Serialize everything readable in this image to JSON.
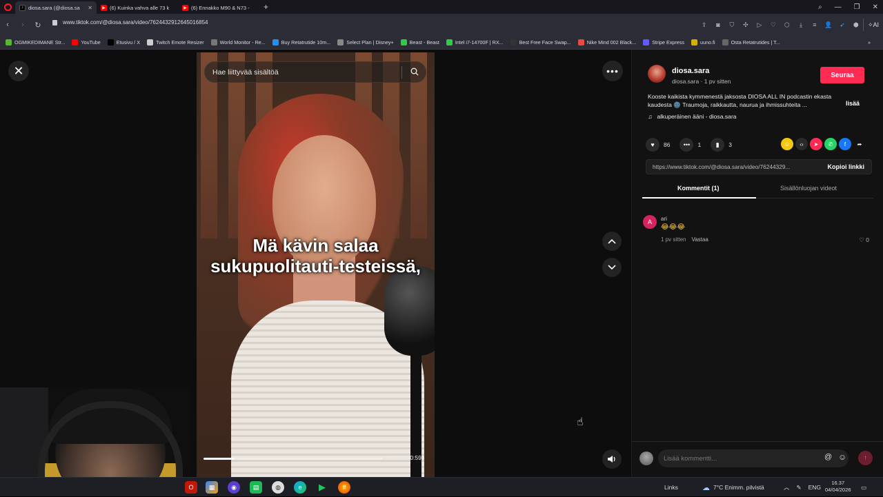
{
  "browser": {
    "tabs": [
      {
        "label": "diosa.sara (@diosa.sa",
        "active": true
      },
      {
        "label": "(6) Kuinka vahva alle 73 k",
        "active": false
      },
      {
        "label": "(6) Ennakko M90 & N73 -",
        "active": false
      }
    ],
    "url": "www.tiktok.com/@diosa.sara/video/7624432912645016854",
    "ai_label": "AI",
    "bookmarks": [
      {
        "label": "OGMIKEDIMANE Str...",
        "color": "#53b82e"
      },
      {
        "label": "YouTube",
        "color": "#ff0000"
      },
      {
        "label": "Etusivu / X",
        "color": "#000000"
      },
      {
        "label": "Twitch Emote Resizer",
        "color": "#cccccc"
      },
      {
        "label": "World Monitor - Re...",
        "color": "#777777"
      },
      {
        "label": "Buy Retatrutide 10m...",
        "color": "#1e90ff"
      },
      {
        "label": "Select Plan | Disney+",
        "color": "#888888"
      },
      {
        "label": "Beast - Beast",
        "color": "#2ecc40"
      },
      {
        "label": "Intel i7-14700F | RX...",
        "color": "#2ecc40"
      },
      {
        "label": "Best Free Face Swap...",
        "color": "#333333"
      },
      {
        "label": "Nike Mind 002 Black...",
        "color": "#e74c3c"
      },
      {
        "label": "Stripe Express",
        "color": "#635bff"
      },
      {
        "label": "uuno.fi",
        "color": "#d4b000"
      },
      {
        "label": "Osta Retatrutides | T...",
        "color": "#666666"
      }
    ]
  },
  "player": {
    "search_placeholder": "Hae liittyvää sisältöä",
    "subtitle": "Mä kävin salaa sukupuolitauti-testeissä,",
    "time": "00:10/00:59",
    "progress": 0.17
  },
  "post": {
    "author": "diosa.sara",
    "meta": "diosa.sara · 1 pv sitten",
    "follow_label": "Seuraa",
    "description": "Kooste kaikista kymmenestä jaksosta DIOSA ALL IN podcastin ekasta kaudesta 🌚 Traumoja, raikkautta, naurua ja ihmissuhteita ...",
    "more_label": "lisää",
    "sound": "alkuperäinen ääni - diosa.sara",
    "likes": "86",
    "comments": "1",
    "saves": "3",
    "link": "https://www.tiktok.com/@diosa.sara/video/76244329...",
    "copy_link_label": "Kopioi linkki",
    "tab_comments": "Kommentit (1)",
    "tab_creator_videos": "Sisällönluojan videot"
  },
  "comment": {
    "avatar_letter": "A",
    "user": "ari",
    "text": "😂😂😂",
    "time": "1 pv sitten",
    "reply_label": "Vastaa",
    "likes": "0"
  },
  "composer": {
    "placeholder": "Lisää kommentti..."
  },
  "taskbar": {
    "links_label": "Links",
    "weather": "7°C  Enimm. pilvistä",
    "lang": "ENG",
    "time": "16.37",
    "date": "04/04/2026"
  },
  "colors": {
    "accent": "#fe2c55",
    "background": "#121212"
  }
}
